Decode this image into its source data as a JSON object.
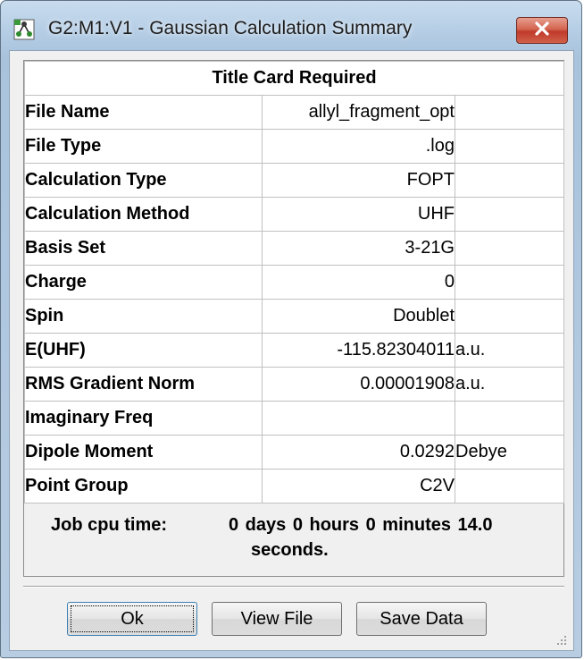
{
  "window": {
    "title": "G2:M1:V1 - Gaussian Calculation Summary",
    "close_icon": "close-x-icon",
    "app_icon": "gaussview-molecule-icon"
  },
  "summary": {
    "header": "Title Card Required",
    "rows": [
      {
        "label": "File Name",
        "value": "allyl_fragment_opt",
        "unit": ""
      },
      {
        "label": "File Type",
        "value": ".log",
        "unit": ""
      },
      {
        "label": "Calculation Type",
        "value": "FOPT",
        "unit": ""
      },
      {
        "label": "Calculation Method",
        "value": "UHF",
        "unit": ""
      },
      {
        "label": "Basis Set",
        "value": "3-21G",
        "unit": ""
      },
      {
        "label": "Charge",
        "value": "0",
        "unit": ""
      },
      {
        "label": "Spin",
        "value": "Doublet",
        "unit": ""
      },
      {
        "label": "E(UHF)",
        "value": "-115.82304011",
        "unit": "a.u."
      },
      {
        "label": "RMS Gradient Norm",
        "value": "0.00001908",
        "unit": "a.u."
      },
      {
        "label": "Imaginary Freq",
        "value": "",
        "unit": ""
      },
      {
        "label": "Dipole Moment",
        "value": "0.0292",
        "unit": "Debye"
      },
      {
        "label": "Point Group",
        "value": "C2V",
        "unit": ""
      }
    ],
    "cpu_label": "Job cpu time:",
    "cpu_value_line1": "0 days  0 hours  0 minutes 14.0",
    "cpu_value_line2": "seconds."
  },
  "buttons": {
    "ok": "Ok",
    "view_file": "View File",
    "save_data": "Save Data"
  },
  "colors": {
    "title_bar": "#b7cfe6",
    "close_button": "#c0392b",
    "dialog_face": "#f0f0f0"
  }
}
